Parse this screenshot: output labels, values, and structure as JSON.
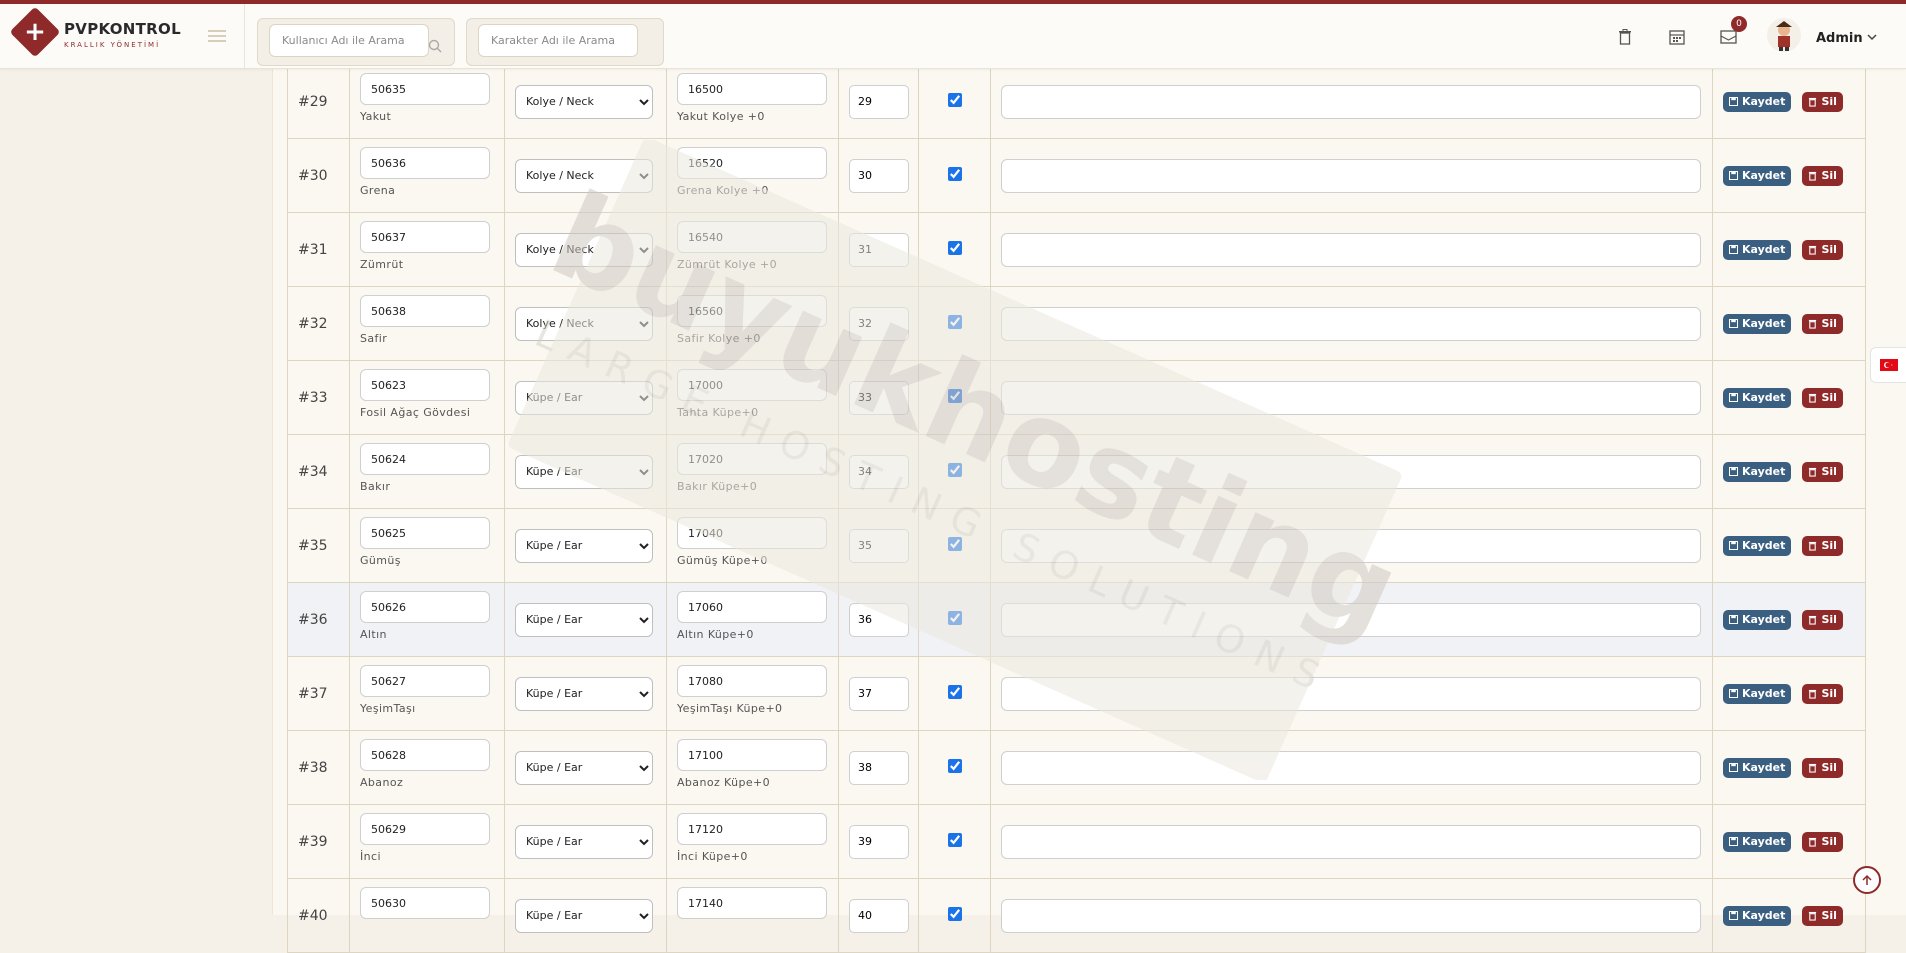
{
  "app": {
    "title": "PVPKONTROL",
    "subtitle": "KRALLIK YÖNETİMİ"
  },
  "search": {
    "user_placeholder": "Kullanıcı Adı ile Arama",
    "character_placeholder": "Karakter Adı ile Arama"
  },
  "header": {
    "notification_count": "0",
    "user_name": "Admin",
    "icons": [
      "trash-icon",
      "calendar-icon",
      "mail-icon"
    ]
  },
  "actions": {
    "save_label": "Kaydet",
    "delete_label": "Sil"
  },
  "rows": [
    {
      "id": "#29",
      "code": "50635",
      "name": "Yakut",
      "type": "Kolye / Neck",
      "value": "16500",
      "value_label": "Yakut Kolye +0",
      "order": "29",
      "active": true
    },
    {
      "id": "#30",
      "code": "50636",
      "name": "Grena",
      "type": "Kolye / Neck",
      "value": "16520",
      "value_label": "Grena Kolye +0",
      "order": "30",
      "active": true
    },
    {
      "id": "#31",
      "code": "50637",
      "name": "Zümrüt",
      "type": "Kolye / Neck",
      "value": "16540",
      "value_label": "Zümrüt Kolye +0",
      "order": "31",
      "active": true
    },
    {
      "id": "#32",
      "code": "50638",
      "name": "Safir",
      "type": "Kolye / Neck",
      "value": "16560",
      "value_label": "Safir Kolye +0",
      "order": "32",
      "active": true
    },
    {
      "id": "#33",
      "code": "50623",
      "name": "Fosil Ağaç Gövdesi",
      "type": "Küpe / Ear",
      "value": "17000",
      "value_label": "Tahta Küpe+0",
      "order": "33",
      "active": true
    },
    {
      "id": "#34",
      "code": "50624",
      "name": "Bakır",
      "type": "Küpe / Ear",
      "value": "17020",
      "value_label": "Bakır Küpe+0",
      "order": "34",
      "active": true
    },
    {
      "id": "#35",
      "code": "50625",
      "name": "Gümüş",
      "type": "Küpe / Ear",
      "value": "17040",
      "value_label": "Gümüş Küpe+0",
      "order": "35",
      "active": true
    },
    {
      "id": "#36",
      "code": "50626",
      "name": "Altın",
      "type": "Küpe / Ear",
      "value": "17060",
      "value_label": "Altın Küpe+0",
      "order": "36",
      "active": true
    },
    {
      "id": "#37",
      "code": "50627",
      "name": "YeşimTaşı",
      "type": "Küpe / Ear",
      "value": "17080",
      "value_label": "YeşimTaşı Küpe+0",
      "order": "37",
      "active": true
    },
    {
      "id": "#38",
      "code": "50628",
      "name": "Abanoz",
      "type": "Küpe / Ear",
      "value": "17100",
      "value_label": "Abanoz Küpe+0",
      "order": "38",
      "active": true
    },
    {
      "id": "#39",
      "code": "50629",
      "name": "İnci",
      "type": "Küpe / Ear",
      "value": "17120",
      "value_label": "İnci Küpe+0",
      "order": "39",
      "active": true
    },
    {
      "id": "#40",
      "code": "50630",
      "name": "",
      "type": "Küpe / Ear",
      "value": "17140",
      "value_label": "",
      "order": "40",
      "active": true
    }
  ],
  "watermark": {
    "main": "buyukhosting",
    "tagline": "LARGE HOSTING SOLUTIONS"
  },
  "colors": {
    "brand": "#8f2a2a",
    "save_button": "#3b5f80",
    "delete_button": "#8f2a2a",
    "page_bg": "#f5f1e8"
  },
  "language_flag": "turkey-flag-icon"
}
